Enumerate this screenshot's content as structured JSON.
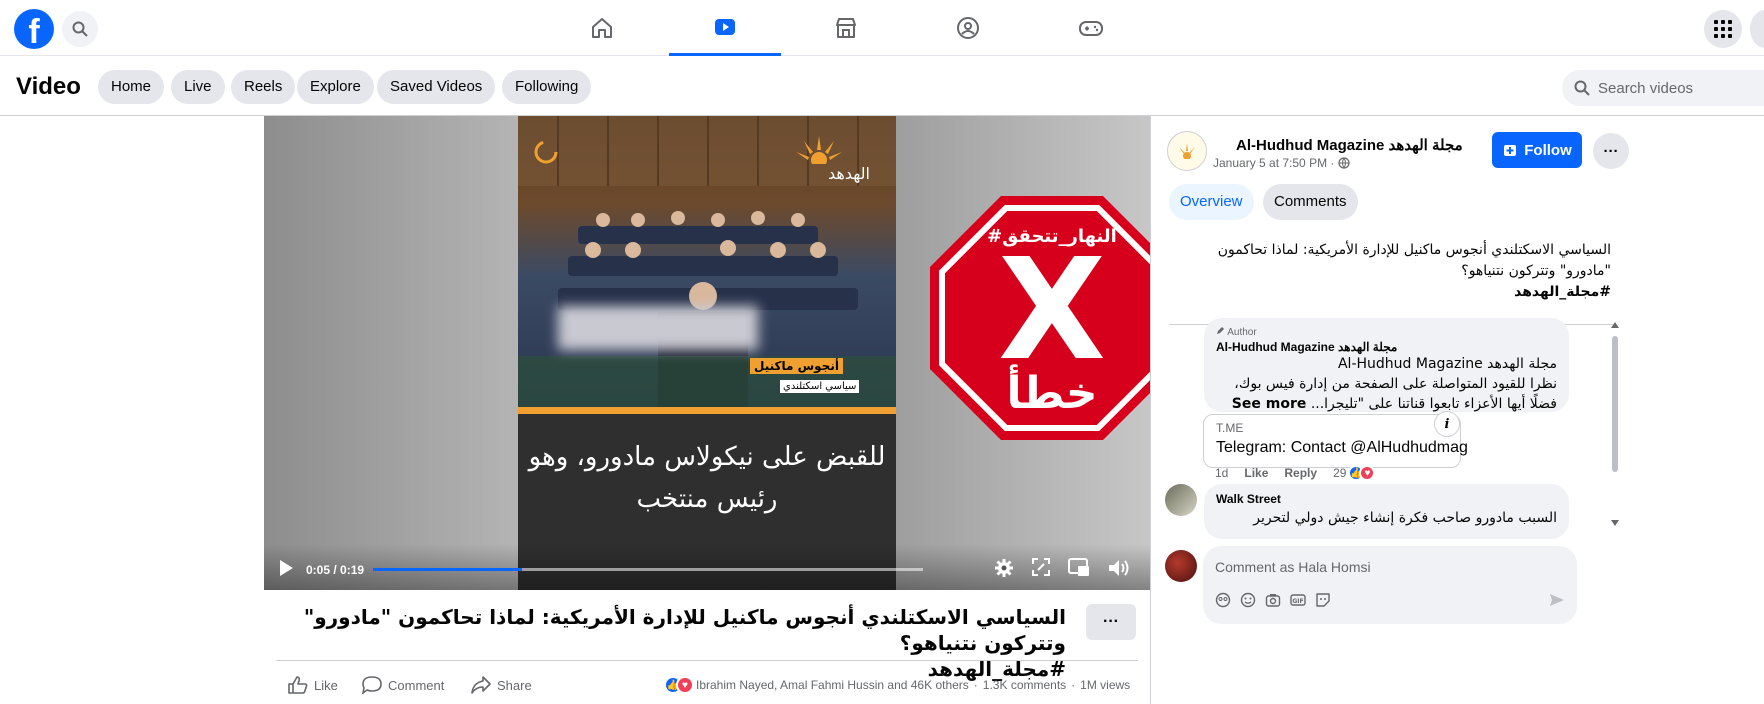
{
  "topbar": {
    "logo": "f",
    "icons": [
      "search-icon",
      "home-icon",
      "video-icon",
      "marketplace-icon",
      "groups-icon",
      "gaming-icon",
      "apps-grid-icon"
    ],
    "accent_color": "#0866ff"
  },
  "subbar": {
    "title": "Video",
    "tabs": [
      "Home",
      "Live",
      "Reels",
      "Explore",
      "Saved Videos",
      "Following"
    ],
    "search_placeholder": "Search videos"
  },
  "video": {
    "brand": "الهدهد",
    "speaker_name": "أنجوس ماكنيل",
    "speaker_role": "سياسي اسكتلندي",
    "subtitle_line1": "للقبض على نيكولاس مادورو، وهو",
    "subtitle_line2": "رئيس منتخب",
    "stamp_hashtag": "#النهار_تتحقق",
    "stamp_letter": "X",
    "stamp_word": "خطأ",
    "stamp_color": "#d6001c",
    "time": "0:05 / 0:19",
    "progress": 0.27
  },
  "post": {
    "title": "السياسي الاسكتلندي أنجوس ماكنيل للإدارة الأمريكية: لماذا تحاكمون \"مادورو\" وتتركون نتنياهو؟",
    "hashtag": "#مجلة_الهدهد",
    "more": "···",
    "like": "Like",
    "comment": "Comment",
    "share": "Share",
    "reactions_text": "Ibrahim Nayed, Amal Fahmi Hussin and 46K others",
    "comments_count": "1.3K comments",
    "views": "1M views"
  },
  "panel": {
    "page_name": "Al-Hudhud Magazine مجلة الهدهد",
    "time": "January 5 at 7:50 PM ·",
    "follow": "Follow",
    "more": "···",
    "tab_overview": "Overview",
    "tab_comments": "Comments",
    "post_text": "السياسي الاسكتلندي أنجوس ماكنيل للإدارة الأمريكية: لماذا تحاكمون \"مادورو\" وتتركون نتنياهو؟",
    "post_hashtag": "#مجلة_الهدهد",
    "sort": "relevant"
  },
  "comments": [
    {
      "badge": "Author",
      "name": "Al-Hudhud Magazine مجلة الهدهد",
      "line1": "مجلة الهدهد Al-Hudhud Magazine",
      "line2": "نظرا للقيود المتواصلة على الصفحة من إدارة فيس بوك،",
      "line3": "فضلًا أيها الأعزاء تابعوا قناتنا على \"تليجرا...",
      "see_more": "See more",
      "link_domain": "T.ME",
      "link_title": "Telegram: Contact @AlHudhudmag",
      "age": "1d",
      "like": "Like",
      "reply": "Reply",
      "reactions": "29"
    },
    {
      "name": "Walk Street",
      "line1": "السبب مادورو صاحب فكرة إنشاء جيش دولي لتحرير"
    }
  ],
  "composer": {
    "placeholder": "Comment as Hala Homsi"
  }
}
